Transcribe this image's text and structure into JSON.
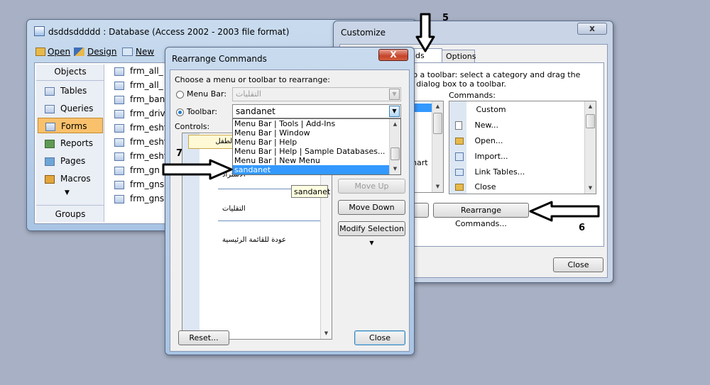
{
  "access_window": {
    "title": "dsddsddddd : Database (Access 2002 - 2003 file format)",
    "toolbar": {
      "open": "Open",
      "design": "Design",
      "new": "New"
    },
    "objects_header": "Objects",
    "objects": [
      "Tables",
      "Queries",
      "Forms",
      "Reports",
      "Pages",
      "Macros"
    ],
    "selected_object": "Forms",
    "groups": "Groups",
    "forms": [
      "frm_all_",
      "frm_all_",
      "frm_ban",
      "frm_driv",
      "frm_esht",
      "frm_esht",
      "frm_esht",
      "frm_gn",
      "frm_gns",
      "frm_gns"
    ]
  },
  "customize": {
    "title": "Customize",
    "tab_commands_partial": "nds",
    "tab_options": "Options",
    "desc_line1": "to a toolbar: select a category and drag the",
    "desc_line2": "s dialog box to a toolbar.",
    "commands_label": "Commands:",
    "commands": [
      "Custom",
      "New...",
      "Open...",
      "Import...",
      "Link Tables...",
      "Close"
    ],
    "partial_item": "hart",
    "rearrange_button": "Rearrange Commands...",
    "close_button": "Close",
    "close_glyph": "x"
  },
  "rearrange": {
    "title": "Rearrange Commands",
    "choose_label": "Choose a menu or toolbar to rearrange:",
    "menu_bar_label": "Menu Bar:",
    "menu_bar_value": "التقليات",
    "toolbar_label": "Toolbar:",
    "toolbar_value": "sandanet",
    "controls_label": "Controls:",
    "dropdown_items": [
      "Menu Bar | Tools | Add-Ins",
      "Menu Bar | Window",
      "Menu Bar | Help",
      "Menu Bar | Help | Sample Databases...",
      "Menu Bar | New Menu",
      "sandanet"
    ],
    "selected_dropdown": "sandanet",
    "tooltip": "sandanet",
    "preview_items": [
      "الطفل",
      "الاستراد",
      "التقليات",
      "عودة للقائمة الرئيسية"
    ],
    "move_up": "Move Up",
    "move_down": "Move Down",
    "modify_selection": "Modify Selection",
    "reset": "Reset...",
    "close": "Close",
    "close_glyph": "X"
  },
  "annotations": {
    "step5": "5",
    "step6": "6",
    "step7": "7"
  },
  "colors": {
    "desktop": "#a7b0c4",
    "selection": "#3399ff",
    "forms_highlight": "#f9c16c"
  }
}
